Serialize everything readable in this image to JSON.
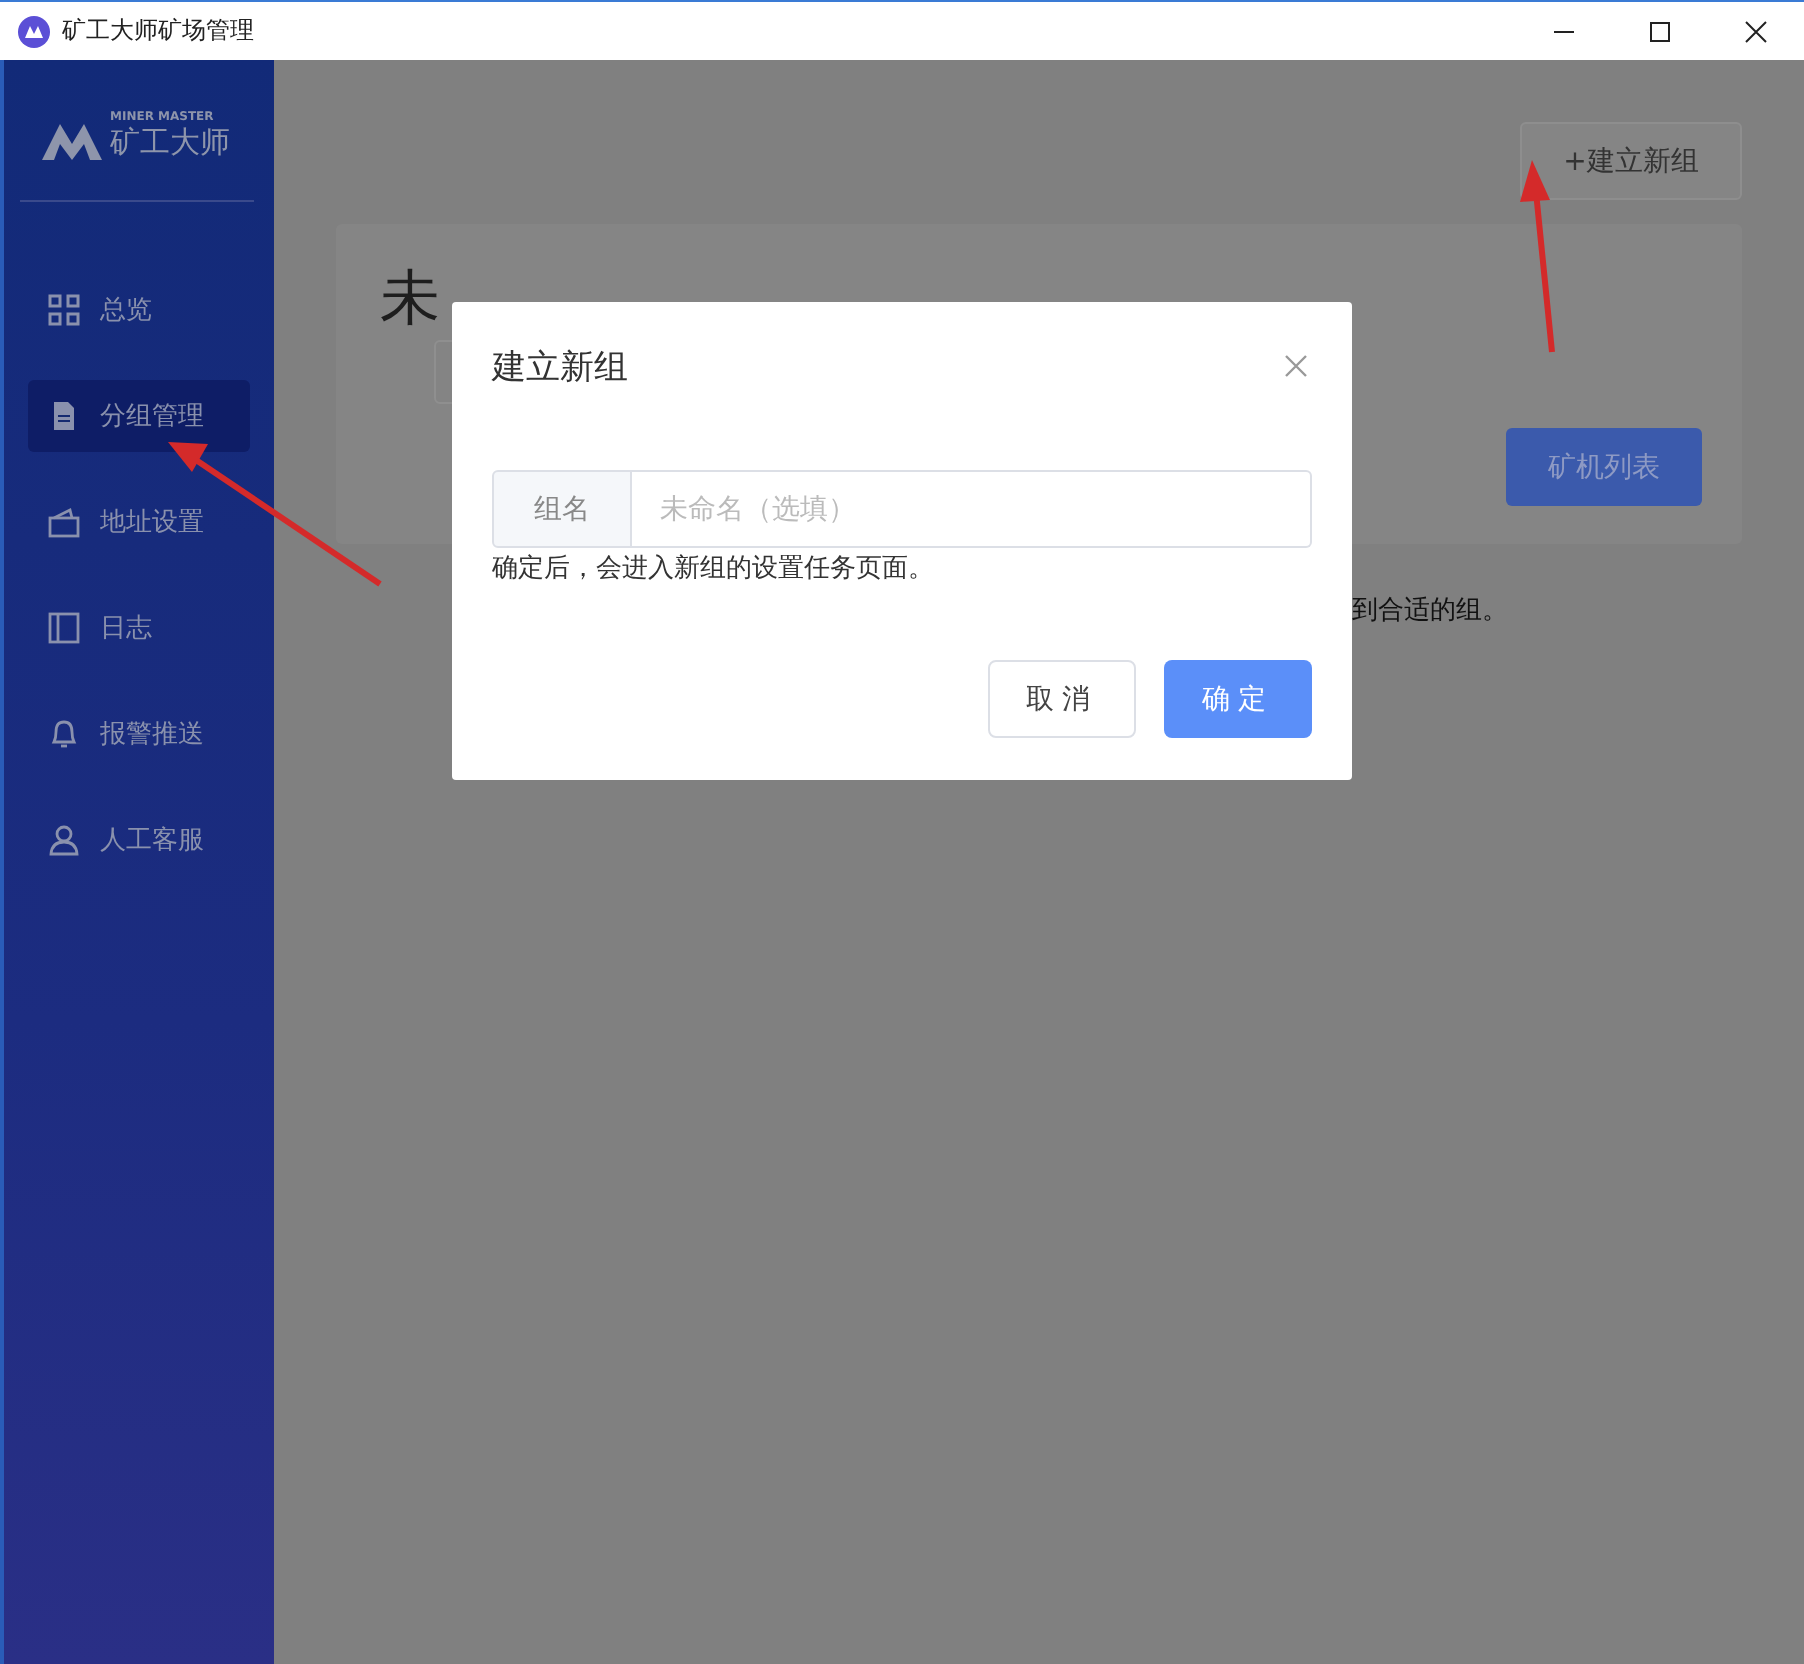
{
  "window": {
    "title": "矿工大师矿场管理"
  },
  "logo": {
    "tagline": "MINER MASTER",
    "name": "矿工大师"
  },
  "sidebar": {
    "items": [
      {
        "label": "总览",
        "kind": "grid",
        "selected": false
      },
      {
        "label": "分组管理",
        "kind": "document",
        "selected": true
      },
      {
        "label": "地址设置",
        "kind": "wallet",
        "selected": false
      },
      {
        "label": "日志",
        "kind": "panel",
        "selected": false
      },
      {
        "label": "报警推送",
        "kind": "bell",
        "selected": false
      },
      {
        "label": "人工客服",
        "kind": "person",
        "selected": false
      }
    ]
  },
  "new_group_button": "+建立新组",
  "group_card": {
    "title": "未",
    "list_button": "矿机列表"
  },
  "hint_tail": "到合适的组。",
  "dialog": {
    "title": "建立新组",
    "field": {
      "label": "组名",
      "placeholder": "未命名（选填）"
    },
    "note": "确定后，会进入新组的设置任务页面。",
    "buttons": [
      {
        "label": "取消",
        "kind": "secondary"
      },
      {
        "label": "确定",
        "kind": "primary"
      }
    ]
  }
}
